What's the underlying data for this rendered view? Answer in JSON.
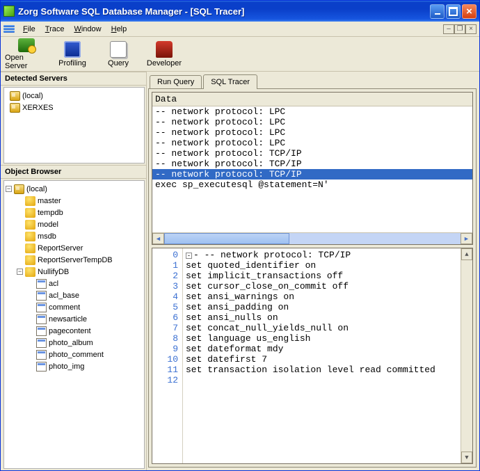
{
  "titlebar": {
    "title": "Zorg Software SQL Database Manager - [SQL Tracer]"
  },
  "menu": {
    "file": "File",
    "trace": "Trace",
    "window": "Window",
    "help": "Help"
  },
  "toolbar": {
    "open_server": "Open Server",
    "profiling": "Profiling",
    "query": "Query",
    "developer": "Developer"
  },
  "left": {
    "detected_title": "Detected Servers",
    "detected_items": [
      "(local)",
      "XERXES"
    ],
    "object_browser_title": "Object Browser",
    "root": "(local)",
    "dbs": [
      "master",
      "tempdb",
      "model",
      "msdb",
      "ReportServer",
      "ReportServerTempDB"
    ],
    "nullify_db": "NullifyDB",
    "tables": [
      "acl",
      "acl_base",
      "comment",
      "newsarticle",
      "pagecontent",
      "photo_album",
      "photo_comment",
      "photo_img"
    ]
  },
  "tabs": {
    "run_query": "Run Query",
    "sql_tracer": "SQL Tracer"
  },
  "datapane": {
    "head": "Data",
    "rows": [
      "-- network protocol: LPC",
      "-- network protocol: LPC",
      "-- network protocol: LPC",
      "-- network protocol: LPC",
      "-- network protocol: TCP/IP",
      "-- network protocol: TCP/IP",
      "-- network protocol: TCP/IP",
      "exec sp_executesql @statement=N'"
    ],
    "selected_index": 6
  },
  "code": {
    "lines": [
      "-- network protocol: TCP/IP",
      "set quoted_identifier on",
      "set implicit_transactions off",
      "set cursor_close_on_commit off",
      "set ansi_warnings on",
      "set ansi_padding on",
      "set ansi_nulls on",
      "set concat_null_yields_null on",
      "set language us_english",
      "set dateformat mdy",
      "set datefirst 7",
      "set transaction isolation level read committed",
      ""
    ]
  }
}
